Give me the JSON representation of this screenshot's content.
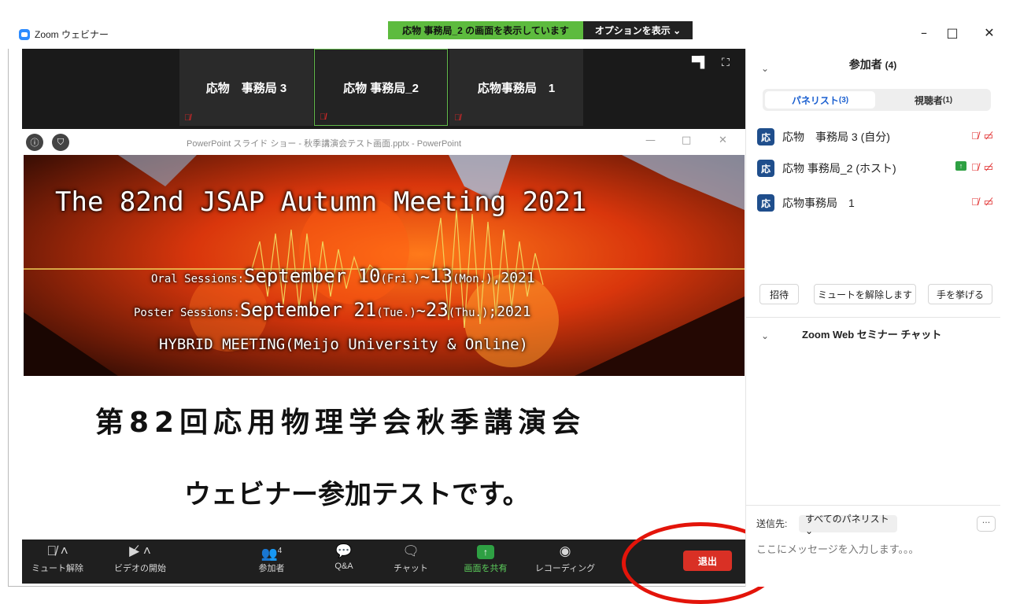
{
  "window": {
    "app_title": "Zoom ウェビナー",
    "minimize": "–",
    "maximize": "□",
    "close": "✕"
  },
  "share_bar": {
    "banner": "応物 事務局_2 の画面を表示しています",
    "options": "オプションを表示 ⌄"
  },
  "video_tiles": [
    {
      "name": "応物　事務局 3"
    },
    {
      "name": "応物 事務局_2"
    },
    {
      "name": "応物事務局　1"
    }
  ],
  "ppt": {
    "title": "PowerPoint スライド ショー - 秋季講演会テスト画面.pptx - PowerPoint",
    "min": "—",
    "max": "□",
    "close": "✕"
  },
  "slide": {
    "headline": "The 82nd JSAP Autumn Meeting 2021",
    "oral": {
      "label": "Oral Sessions:",
      "month": "September ",
      "d1": "10",
      "w1": "(Fri.)",
      "sep": "~",
      "d2": "13",
      "w2": "(Mon.)",
      "year": ",2021"
    },
    "poster": {
      "label": "Poster Sessions:",
      "month": "September ",
      "d1": "21",
      "w1": "(Tue.)",
      "sep": "~",
      "d2": "23",
      "w2": "(Thu.)",
      "year": ";2021"
    },
    "hybrid": "HYBRID MEETING(Meijo University & Online)",
    "jp_title": "第82回応用物理学会秋季講演会",
    "jp_subtitle": "ウェビナー参加テストです。"
  },
  "toolbar": {
    "unmute": "ミュート解除",
    "start_video": "ビデオの開始",
    "participants": "参加者",
    "participants_count": "4",
    "qa": "Q&A",
    "chat": "チャット",
    "share_screen": "画面を共有",
    "recording": "レコーディング",
    "leave": "退出"
  },
  "panel": {
    "title": "参加者",
    "count": "(4)",
    "tab_panelists": "パネリスト",
    "tab_panelists_count": "(3)",
    "tab_attendees": "視聴者",
    "tab_attendees_count": "(1)",
    "participants": [
      {
        "avatar": "応",
        "name": "応物　事務局 3 (自分)"
      },
      {
        "avatar": "応",
        "name": "応物 事務局_2 (ホスト)"
      },
      {
        "avatar": "応",
        "name": "応物事務局　1"
      }
    ],
    "invite": "招待",
    "unmute_me": "ミュートを解除します",
    "raise_hand": "手を挙げる"
  },
  "chat": {
    "title": "Zoom Web セミナー チャット",
    "send_to_label": "送信先:",
    "send_to_value": "すべてのパネリスト ⌄",
    "more": "···",
    "input_placeholder": "ここにメッセージを入力します。。。"
  },
  "colors": {
    "zoom_blue": "#2d8cff",
    "share_green": "#5dbb3e",
    "leave_red": "#d93025",
    "annotation_red": "#e3140a"
  }
}
